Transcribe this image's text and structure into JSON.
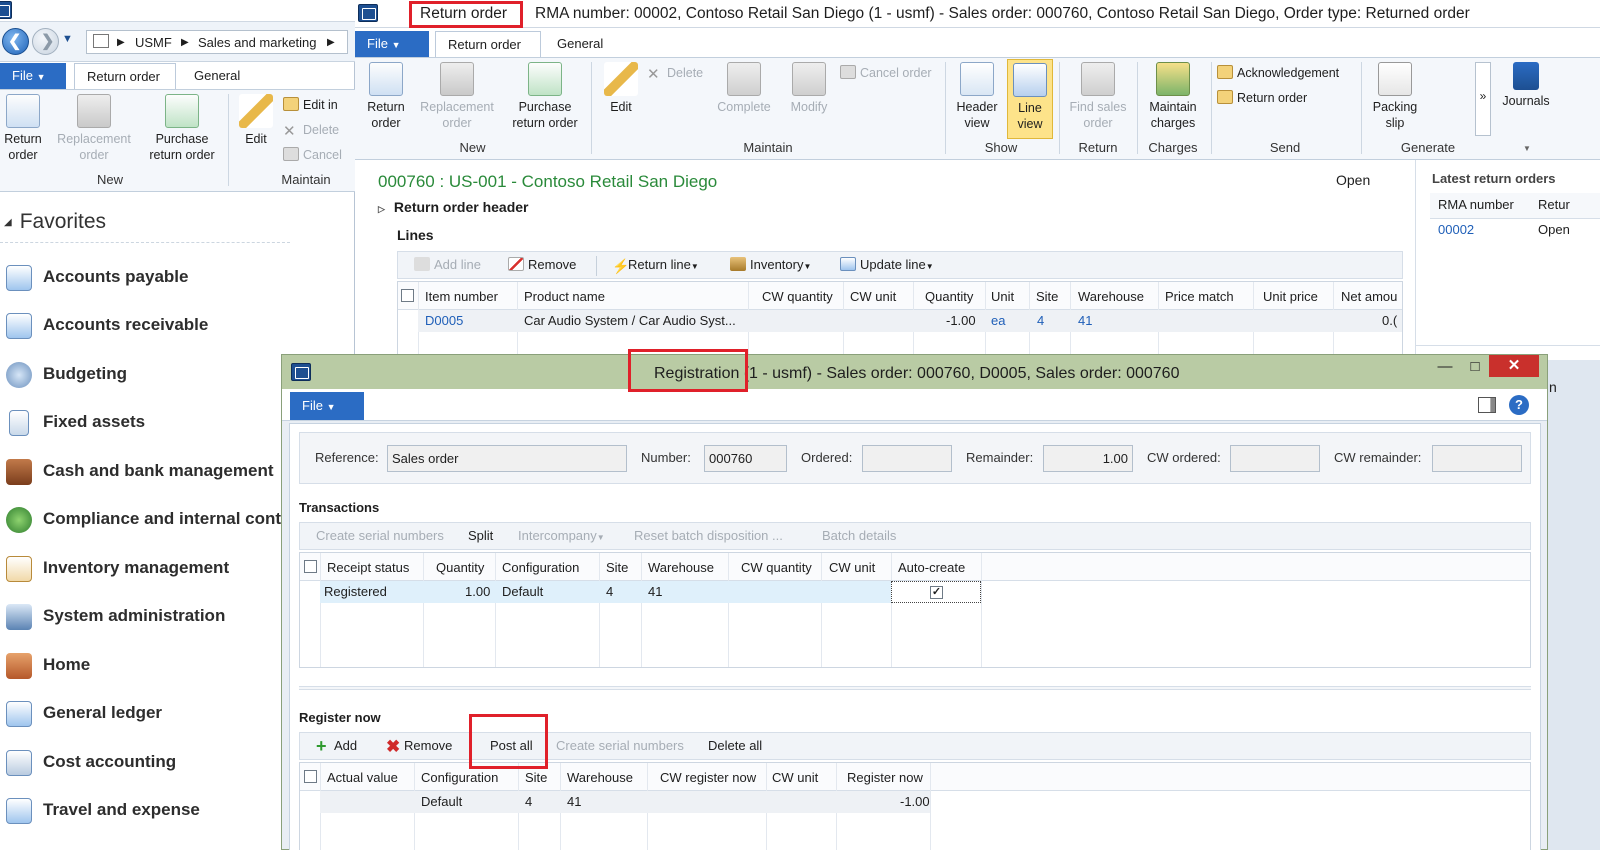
{
  "left_window": {
    "breadcrumb": [
      "USMF",
      "Sales and marketing"
    ],
    "tabs": {
      "file": "File",
      "return_order": "Return order",
      "general": "General"
    },
    "ribbon": {
      "return_order": "Return order",
      "replacement_order": "Replacement order",
      "purchase_return_order": "Purchase return order",
      "edit": "Edit",
      "edit_in": "Edit in",
      "delete": "Delete",
      "cancel": "Cancel",
      "group_new": "New",
      "group_maintain": "Maintain"
    },
    "favorites": "Favorites",
    "modules": [
      "Accounts payable",
      "Accounts receivable",
      "Budgeting",
      "Fixed assets",
      "Cash and bank management",
      "Compliance and internal contr",
      "Inventory management",
      "System administration",
      "Home",
      "General ledger",
      "Cost accounting",
      "Travel and expense"
    ]
  },
  "main_window": {
    "title_highlight": "Return order",
    "title_rest": "RMA number: 00002,  Contoso Retail San Diego (1 - usmf) - Sales order: 000760, Contoso Retail San Diego, Order type: Returned order",
    "tabs": {
      "file": "File",
      "return_order": "Return order",
      "general": "General"
    },
    "ribbon": {
      "return_order": "Return order",
      "replacement_order": "Replacement order",
      "purchase_return_order": "Purchase return order",
      "edit": "Edit",
      "delete": "Delete",
      "complete": "Complete",
      "modify": "Modify",
      "cancel_order": "Cancel order",
      "header_view": "Header view",
      "line_view": "Line view",
      "find_sales_order": "Find sales order",
      "maintain_charges": "Maintain charges",
      "acknowledgement": "Acknowledgement",
      "return_order_send": "Return order",
      "packing_slip": "Packing slip",
      "journals": "Journals",
      "more": "»",
      "groups": {
        "new": "New",
        "maintain": "Maintain",
        "show": "Show",
        "return": "Return",
        "charges": "Charges",
        "send": "Send",
        "generate": "Generate"
      }
    },
    "form_header": "000760 : US-001 - Contoso Retail San Diego",
    "status": "Open",
    "return_order_header": "Return order header",
    "lines_label": "Lines",
    "lines_toolbar": {
      "add_line": "Add line",
      "remove": "Remove",
      "return_line": "Return line",
      "inventory": "Inventory",
      "update_line": "Update line"
    },
    "lines_columns": [
      "Item number",
      "Product name",
      "CW quantity",
      "CW unit",
      "Quantity",
      "Unit",
      "Site",
      "Warehouse",
      "Price match",
      "Unit price",
      "Net amou"
    ],
    "lines_rows": [
      {
        "item_number": "D0005",
        "product_name": "Car Audio System / Car Audio Syst...",
        "quantity": "-1.00",
        "unit": "ea",
        "site": "4",
        "warehouse": "41",
        "net_amount": "0.("
      }
    ],
    "latest_return_orders": {
      "title": "Latest return orders",
      "columns": [
        "RMA number",
        "Retur"
      ],
      "rows": [
        {
          "rma": "00002",
          "status": "Open"
        }
      ],
      "partial_label": "n"
    }
  },
  "registration": {
    "title_highlight": "Registration (",
    "title_rest": "1 - usmf) - Sales order: 000760, D0005, Sales order: 000760",
    "file_tab": "File",
    "fields": {
      "reference_label": "Reference:",
      "reference_value": "Sales order",
      "number_label": "Number:",
      "number_value": "000760",
      "ordered_label": "Ordered:",
      "ordered_value": "",
      "remainder_label": "Remainder:",
      "remainder_value": "1.00",
      "cw_ordered_label": "CW ordered:",
      "cw_ordered_value": "",
      "cw_remainder_label": "CW remainder:",
      "cw_remainder_value": ""
    },
    "transactions_label": "Transactions",
    "transactions_toolbar": {
      "create_serial_numbers": "Create serial numbers",
      "split": "Split",
      "intercompany": "Intercompany",
      "reset_batch": "Reset batch disposition ...",
      "batch_details": "Batch details"
    },
    "transactions_columns": [
      "Receipt status",
      "Quantity",
      "Configuration",
      "Site",
      "Warehouse",
      "CW quantity",
      "CW unit",
      "Auto-create"
    ],
    "transactions_rows": [
      {
        "receipt_status": "Registered",
        "quantity": "1.00",
        "configuration": "Default",
        "site": "4",
        "warehouse": "41",
        "auto_create": true
      }
    ],
    "register_now_label": "Register now",
    "register_toolbar": {
      "add": "Add",
      "remove": "Remove",
      "post_all": "Post all",
      "create_serial_numbers": "Create serial numbers",
      "delete_all": "Delete all"
    },
    "register_columns": [
      "Actual value",
      "Configuration",
      "Site",
      "Warehouse",
      "CW register now",
      "CW unit",
      "Register now"
    ],
    "register_rows": [
      {
        "configuration": "Default",
        "site": "4",
        "warehouse": "41",
        "register_now": "-1.00"
      }
    ]
  },
  "colors": {
    "highlight_box": "#e0202a",
    "accent_blue": "#2b6cc4",
    "header_green": "#2a8a3a",
    "dialog_title": "#b9cba4",
    "selected_row": "#dff0fb"
  }
}
